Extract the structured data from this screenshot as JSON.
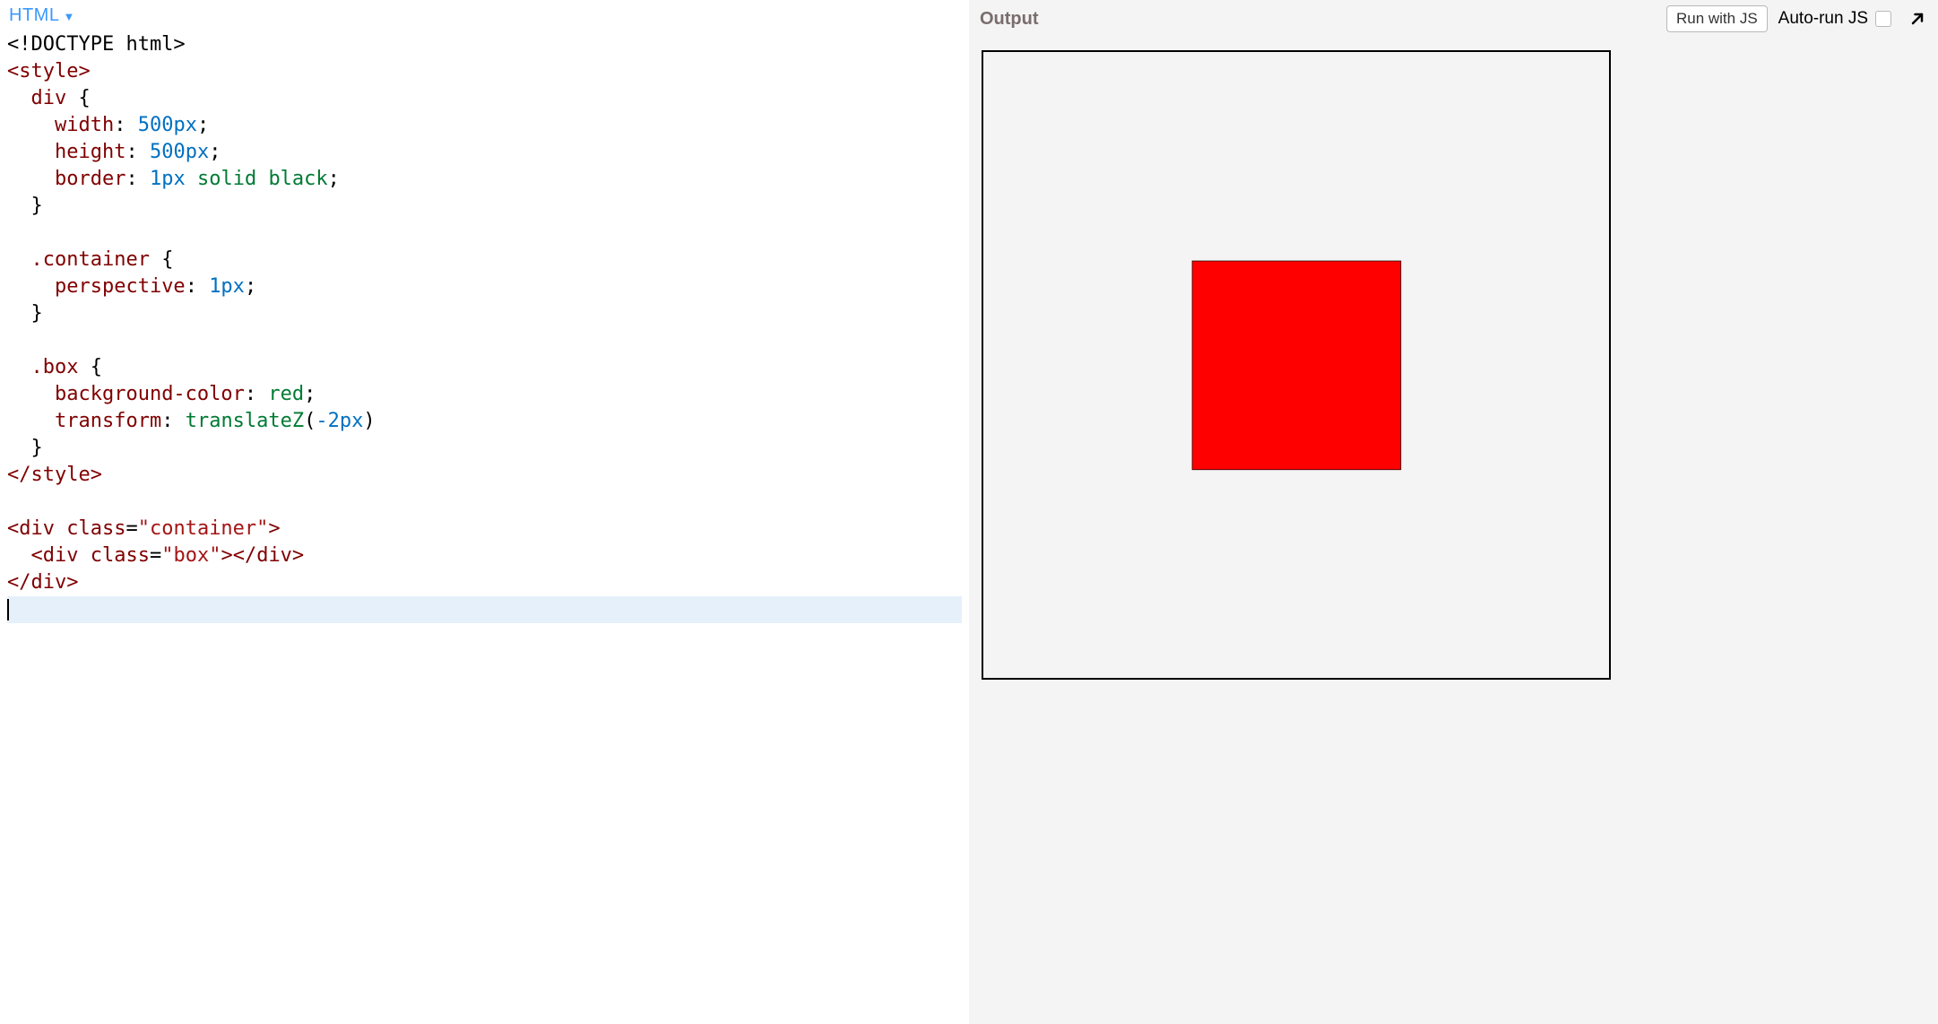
{
  "left": {
    "language_label": "HTML",
    "code_lines": [
      [
        {
          "c": "t-doctype",
          "t": "<!DOCTYPE html>"
        }
      ],
      [
        {
          "c": "t-tag",
          "t": "<style>"
        }
      ],
      [
        {
          "c": "t-plain",
          "t": "  "
        },
        {
          "c": "t-sel",
          "t": "div"
        },
        {
          "c": "t-plain",
          "t": " {"
        }
      ],
      [
        {
          "c": "t-plain",
          "t": "    "
        },
        {
          "c": "t-prop",
          "t": "width"
        },
        {
          "c": "t-punct",
          "t": ":"
        },
        {
          "c": "t-plain",
          "t": " "
        },
        {
          "c": "t-num",
          "t": "500px"
        },
        {
          "c": "t-punct",
          "t": ";"
        }
      ],
      [
        {
          "c": "t-plain",
          "t": "    "
        },
        {
          "c": "t-prop",
          "t": "height"
        },
        {
          "c": "t-punct",
          "t": ":"
        },
        {
          "c": "t-plain",
          "t": " "
        },
        {
          "c": "t-num",
          "t": "500px"
        },
        {
          "c": "t-punct",
          "t": ";"
        }
      ],
      [
        {
          "c": "t-plain",
          "t": "    "
        },
        {
          "c": "t-prop",
          "t": "border"
        },
        {
          "c": "t-punct",
          "t": ":"
        },
        {
          "c": "t-plain",
          "t": " "
        },
        {
          "c": "t-num",
          "t": "1px"
        },
        {
          "c": "t-plain",
          "t": " "
        },
        {
          "c": "t-val",
          "t": "solid black"
        },
        {
          "c": "t-punct",
          "t": ";"
        }
      ],
      [
        {
          "c": "t-plain",
          "t": "  }"
        }
      ],
      [
        {
          "c": "t-plain",
          "t": ""
        }
      ],
      [
        {
          "c": "t-plain",
          "t": "  "
        },
        {
          "c": "t-sel",
          "t": ".container"
        },
        {
          "c": "t-plain",
          "t": " {"
        }
      ],
      [
        {
          "c": "t-plain",
          "t": "    "
        },
        {
          "c": "t-prop",
          "t": "perspective"
        },
        {
          "c": "t-punct",
          "t": ":"
        },
        {
          "c": "t-plain",
          "t": " "
        },
        {
          "c": "t-num",
          "t": "1px"
        },
        {
          "c": "t-punct",
          "t": ";"
        }
      ],
      [
        {
          "c": "t-plain",
          "t": "  }"
        }
      ],
      [
        {
          "c": "t-plain",
          "t": ""
        }
      ],
      [
        {
          "c": "t-plain",
          "t": "  "
        },
        {
          "c": "t-sel",
          "t": ".box"
        },
        {
          "c": "t-plain",
          "t": " {"
        }
      ],
      [
        {
          "c": "t-plain",
          "t": "    "
        },
        {
          "c": "t-prop",
          "t": "background-color"
        },
        {
          "c": "t-punct",
          "t": ":"
        },
        {
          "c": "t-plain",
          "t": " "
        },
        {
          "c": "t-val",
          "t": "red"
        },
        {
          "c": "t-punct",
          "t": ";"
        }
      ],
      [
        {
          "c": "t-plain",
          "t": "    "
        },
        {
          "c": "t-prop",
          "t": "transform"
        },
        {
          "c": "t-punct",
          "t": ":"
        },
        {
          "c": "t-plain",
          "t": " "
        },
        {
          "c": "t-val",
          "t": "translateZ"
        },
        {
          "c": "t-punct",
          "t": "("
        },
        {
          "c": "t-num",
          "t": "-2px"
        },
        {
          "c": "t-punct",
          "t": ")"
        }
      ],
      [
        {
          "c": "t-plain",
          "t": "  }"
        }
      ],
      [
        {
          "c": "t-tag",
          "t": "</style>"
        }
      ],
      [
        {
          "c": "t-plain",
          "t": ""
        }
      ],
      [
        {
          "c": "t-lt",
          "t": "<div"
        },
        {
          "c": "t-plain",
          "t": " "
        },
        {
          "c": "t-attrname",
          "t": "class"
        },
        {
          "c": "t-punct",
          "t": "="
        },
        {
          "c": "t-attr",
          "t": "\"container\""
        },
        {
          "c": "t-lt",
          "t": ">"
        }
      ],
      [
        {
          "c": "t-plain",
          "t": "  "
        },
        {
          "c": "t-lt",
          "t": "<div"
        },
        {
          "c": "t-plain",
          "t": " "
        },
        {
          "c": "t-attrname",
          "t": "class"
        },
        {
          "c": "t-punct",
          "t": "="
        },
        {
          "c": "t-attr",
          "t": "\"box\""
        },
        {
          "c": "t-lt",
          "t": ">"
        },
        {
          "c": "t-lt",
          "t": "</div>"
        }
      ],
      [
        {
          "c": "t-lt",
          "t": "</div>"
        }
      ]
    ],
    "active_line_index": 21
  },
  "right": {
    "output_label": "Output",
    "run_button_label": "Run with JS",
    "autorun_label": "Auto-run JS",
    "autorun_checked": false
  },
  "colors": {
    "link_blue": "#3b99fc",
    "box_red": "#ff0000",
    "panel_gray": "#f4f4f4",
    "output_label": "#7a6d6d"
  }
}
